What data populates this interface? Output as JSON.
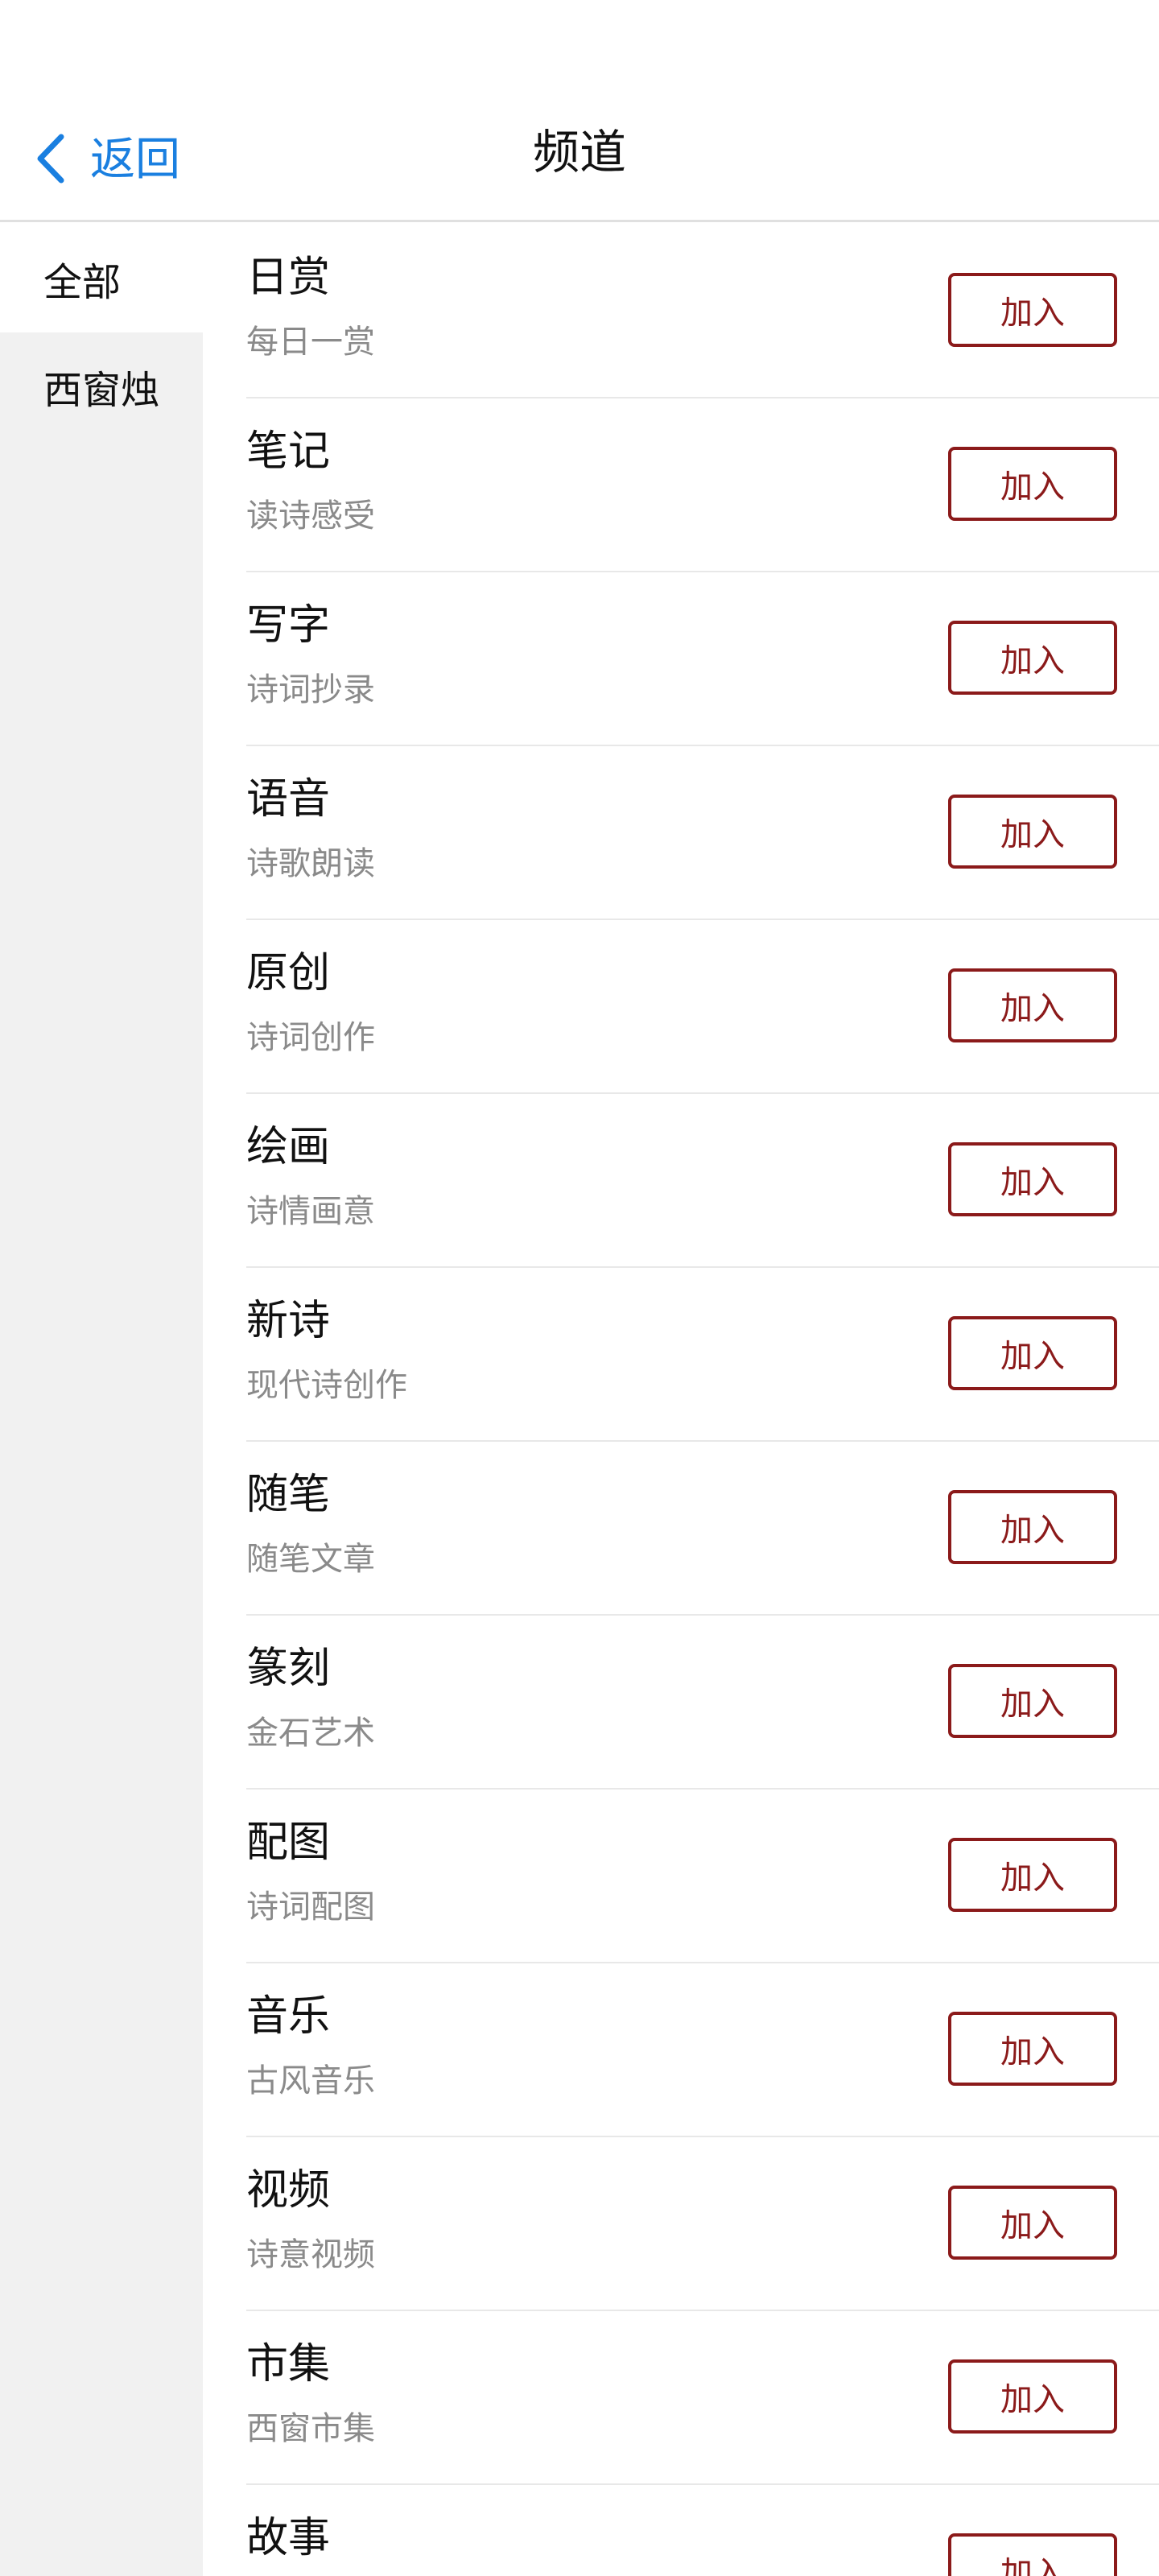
{
  "header": {
    "back_label": "返回",
    "title": "频道"
  },
  "sidebar": {
    "items": [
      {
        "label": "全部",
        "active": true
      },
      {
        "label": "西窗烛",
        "active": false
      }
    ]
  },
  "channels": [
    {
      "name": "日赏",
      "desc": "每日一赏",
      "button": "加入"
    },
    {
      "name": "笔记",
      "desc": "读诗感受",
      "button": "加入"
    },
    {
      "name": "写字",
      "desc": "诗词抄录",
      "button": "加入"
    },
    {
      "name": "语音",
      "desc": "诗歌朗读",
      "button": "加入"
    },
    {
      "name": "原创",
      "desc": "诗词创作",
      "button": "加入"
    },
    {
      "name": "绘画",
      "desc": "诗情画意",
      "button": "加入"
    },
    {
      "name": "新诗",
      "desc": "现代诗创作",
      "button": "加入"
    },
    {
      "name": "随笔",
      "desc": "随笔文章",
      "button": "加入"
    },
    {
      "name": "篆刻",
      "desc": "金石艺术",
      "button": "加入"
    },
    {
      "name": "配图",
      "desc": "诗词配图",
      "button": "加入"
    },
    {
      "name": "音乐",
      "desc": "古风音乐",
      "button": "加入"
    },
    {
      "name": "视频",
      "desc": "诗意视频",
      "button": "加入"
    },
    {
      "name": "市集",
      "desc": "西窗市集",
      "button": "加入"
    },
    {
      "name": "故事",
      "desc": "",
      "button": "加入"
    }
  ],
  "colors": {
    "accent_blue": "#1a7fe0",
    "join_red": "#8b1a1a",
    "sidebar_bg": "#f1f1f1"
  },
  "icons": {
    "back": "chevron-left-icon"
  }
}
